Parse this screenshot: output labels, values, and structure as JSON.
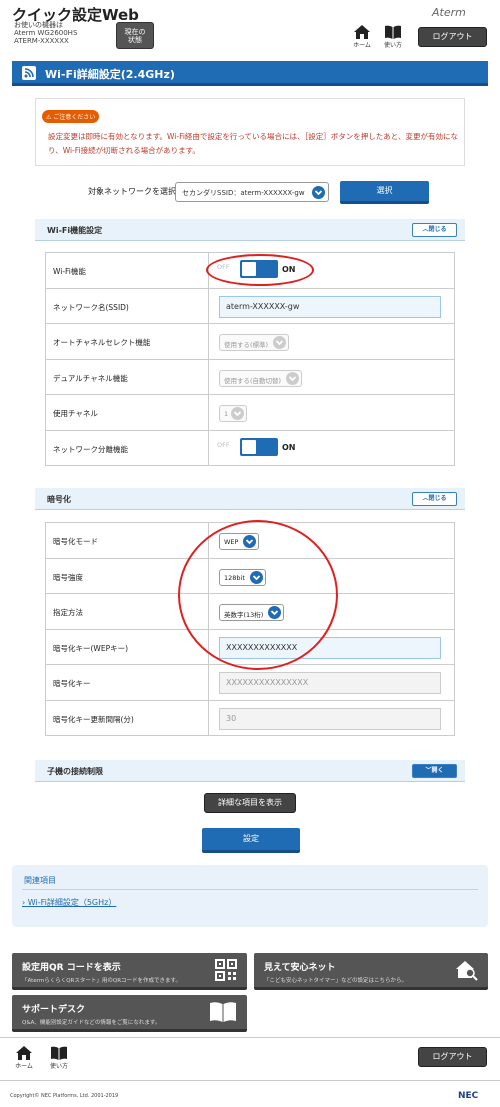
{
  "header": {
    "title": "クイック設定Web",
    "device_lines": [
      "お使いの機器は",
      "Aterm WG2600HS",
      "ATERM-XXXXXX"
    ],
    "status_button": [
      "現在の",
      "状態"
    ],
    "brand": "Aterm",
    "home_label": "ホーム",
    "help_label": "使い方",
    "logout_label": "ログアウト"
  },
  "page_title": "Wi-Fi詳細設定(2.4GHz)",
  "notice": {
    "badge": "ご注意ください",
    "text": "設定変更は即時に有効となります。Wi-Fi経由で設定を行っている場合には、［設定］ボタンを押したあと、変更が有効になり、Wi-Fi接続が切断される場合があります。"
  },
  "network_select": {
    "label": "対象ネットワークを選択",
    "value": "セカンダリSSID：aterm-XXXXXX-gw",
    "button": "選択"
  },
  "wifi_section": {
    "title": "Wi-Fi機能設定",
    "toggle_label": "閉じる",
    "rows": {
      "wifi": {
        "label": "Wi-Fi機能",
        "off": "OFF",
        "on": "ON"
      },
      "ssid": {
        "label": "ネットワーク名(SSID)",
        "value": "aterm-XXXXXX-gw"
      },
      "autochannel": {
        "label": "オートチャネルセレクト機能",
        "value": "使用する(標準)"
      },
      "dualchannel": {
        "label": "デュアルチャネル機能",
        "value": "使用する(自動切替)"
      },
      "channel": {
        "label": "使用チャネル",
        "value": "1"
      },
      "separation": {
        "label": "ネットワーク分離機能",
        "off": "OFF",
        "on": "ON"
      }
    }
  },
  "enc_section": {
    "title": "暗号化",
    "toggle_label": "閉じる",
    "rows": {
      "mode": {
        "label": "暗号化モード",
        "value": "WEP"
      },
      "strength": {
        "label": "暗号強度",
        "value": "128bit"
      },
      "method": {
        "label": "指定方法",
        "value": "英数字(13桁)"
      },
      "wepkey": {
        "label": "暗号化キー(WEPキー)",
        "value": "XXXXXXXXXXXXX"
      },
      "key": {
        "label": "暗号化キー",
        "value": "XXXXXXXXXXXXXXX"
      },
      "interval": {
        "label": "暗号化キー更新間隔(分)",
        "value": "30"
      }
    }
  },
  "client_section": {
    "title": "子機の接続制限",
    "toggle_label": "開く"
  },
  "detail_button": "詳細な項目を表示",
  "submit_button": "設定",
  "related": {
    "title": "関連項目",
    "link": "Wi-Fi詳細設定（5GHz）"
  },
  "tiles": {
    "qr": {
      "title": "設定用QR コードを表示",
      "desc": "「AtermらくらくQRスタート」用のQRコードを作成できます。"
    },
    "safe": {
      "title": "見えて安心ネット",
      "desc": "「こども安心ネットタイマー」などの設定はこちらから。"
    },
    "support": {
      "title": "サポートデスク",
      "desc": "Q&A、機能別設定ガイドなどの情報をご覧になれます。"
    }
  },
  "footer": {
    "home_label": "ホーム",
    "help_label": "使い方",
    "logout_label": "ログアウト",
    "copyright": "Copyright© NEC Platforms, Ltd. 2001-2019",
    "logo": "NEC"
  },
  "colors": {
    "primary": "#1f6bb4",
    "warning": "#c0392b",
    "badge": "#e65c00",
    "annotation": "#e02020"
  }
}
